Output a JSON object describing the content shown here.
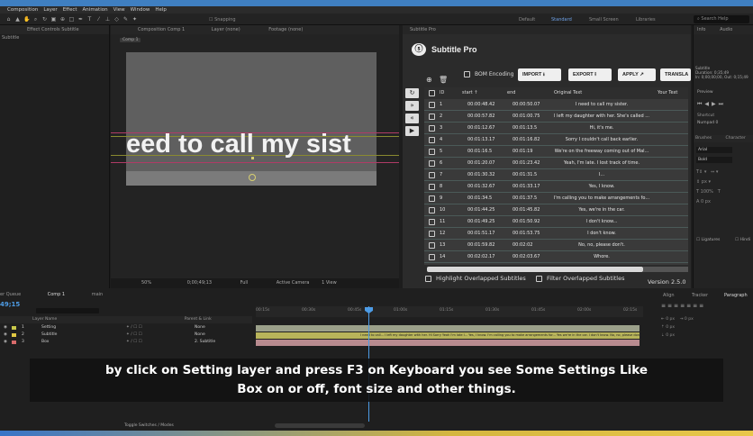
{
  "menu": [
    "Composition",
    "Layer",
    "Effect",
    "Animation",
    "View",
    "Window",
    "Help"
  ],
  "toolbar": {
    "snapping": "Snapping"
  },
  "workspaces": [
    "Default",
    "Standard",
    "Small Screen",
    "Libraries"
  ],
  "search_help": "Search Help",
  "left_panel": {
    "header": "Effect Controls Subtitle",
    "sub": "Subtitle"
  },
  "comp_panel": {
    "header": "Composition Comp 1",
    "layer": "Layer (none)",
    "footage": "Footage (none)",
    "tab": "Comp 1",
    "text": "eed to call my sist",
    "zoom": "50%",
    "timecode": "0;00;49;13",
    "quality": "Full",
    "camera": "Active Camera",
    "view": "1 View"
  },
  "subtitle_pro": {
    "panel_header": "Subtitle Pro",
    "title": "Subtitle Pro",
    "bom_label": "BOM Encoding",
    "import_label": "IMPORT",
    "export_label": "EXPORT",
    "apply_label": "APPLY",
    "translate_label": "TRANSLA",
    "columns": {
      "id": "ID",
      "start": "start ↑",
      "end": "end",
      "original": "Original Text",
      "your": "Your Text"
    },
    "rows": [
      {
        "id": "1",
        "start": "00:00:48.42",
        "end": "00:00:50.07",
        "text": "I need to call my sister."
      },
      {
        "id": "2",
        "start": "00:00:57.82",
        "end": "00:01:00.75",
        "text": "I left my daughter with her. She's called ..."
      },
      {
        "id": "3",
        "start": "00:01:12.67",
        "end": "00:01:13.5",
        "text": "Hi, it's me."
      },
      {
        "id": "4",
        "start": "00:01:13.17",
        "end": "00:01:16.82",
        "text": "Sorry I couldn't call back earlier."
      },
      {
        "id": "5",
        "start": "00:01:16.5",
        "end": "00:01:19",
        "text": "We're on the freeway coming out of Mal..."
      },
      {
        "id": "6",
        "start": "00:01:20.07",
        "end": "00:01:23.42",
        "text": "Yeah, I'm late. I lost track of time."
      },
      {
        "id": "7",
        "start": "00:01:30.32",
        "end": "00:01:31.5",
        "text": "I..."
      },
      {
        "id": "8",
        "start": "00:01:32.67",
        "end": "00:01:33.17",
        "text": "Yes, I know."
      },
      {
        "id": "9",
        "start": "00:01:34.5",
        "end": "00:01:37.5",
        "text": "I'm calling you to make arrangements fo..."
      },
      {
        "id": "10",
        "start": "00:01:44.25",
        "end": "00:01:45.82",
        "text": "Yes, we're in the car."
      },
      {
        "id": "11",
        "start": "00:01:49.25",
        "end": "00:01:50.92",
        "text": "I don't know..."
      },
      {
        "id": "12",
        "start": "00:01:51.17",
        "end": "00:01:53.75",
        "text": "I don't know."
      },
      {
        "id": "13",
        "start": "00:01:59.82",
        "end": "00:02:02",
        "text": "No, no, please don't."
      },
      {
        "id": "14",
        "start": "00:02:02.17",
        "end": "00:02:03.67",
        "text": "Whore."
      }
    ],
    "highlight_label": "Highlight Overlapped Subtitles",
    "filter_label": "Filter Overlapped Subtitles",
    "version": "Version 2.5.0"
  },
  "right_panel": {
    "info_tab": "Info",
    "audio_tab": "Audio",
    "info_lines": [
      "Subtitle",
      "Duration: 0;35;49",
      "In: 0;00;00;00, Out: 0;15;49"
    ],
    "preview": "Preview",
    "shortcut": "Shortcut",
    "numpad": "Numpad 0",
    "brushes": "Brushes",
    "character": "Character",
    "font": "Arial",
    "style": "Bold",
    "ligatures": "Ligatures",
    "hindi": "Hindi"
  },
  "timeline": {
    "render_queue": "er Queue",
    "comp_tab": "Comp 1",
    "main_tab": "main",
    "time": "49;15",
    "header": "Layer Name",
    "parent_header": "Parent & Link",
    "layers": [
      {
        "num": "1",
        "name": "Setting",
        "parent": "None",
        "color": "#c9c84a"
      },
      {
        "num": "2",
        "name": "Subtitle",
        "parent": "None",
        "color": "#e0c843"
      },
      {
        "num": "3",
        "name": "Box",
        "parent": "2. Subtitle",
        "color": "#d86a6a"
      }
    ],
    "ruler": [
      "00:15s",
      "00:30s",
      "00:45s",
      "01:00s",
      "01:15s",
      "01:30s",
      "01:45s",
      "02:00s",
      "02:15s"
    ],
    "track_text": "I need to call... I left my daughter with her. Hi Sorry Yeah I'm late I... Yes, I know. I'm calling you to make arrangements for... Yes we're in the car. I don't know. No, no, please don't. Whore.",
    "footer": "Toggle Switches / Modes",
    "align_tab": "Align",
    "tracker_tab": "Tracker",
    "paragraph_tab": "Paragraph"
  },
  "caption": {
    "line1": "by click on Setting layer and press F3 on Keyboard you see Some Settings Like",
    "line2": "Box on or off, font size and other things."
  },
  "colors": {
    "accent": "#4d9ce6",
    "grid_bg": "#3a3a3a",
    "caption_bg": "#121212"
  }
}
